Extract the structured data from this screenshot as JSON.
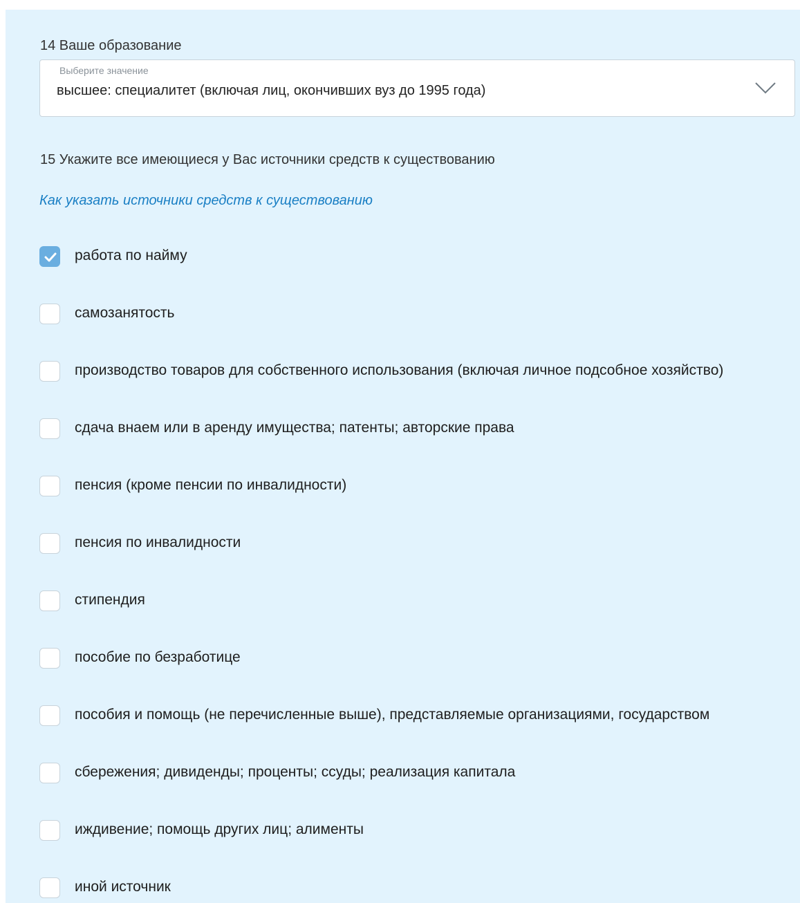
{
  "education": {
    "label": "14 Ваше образование",
    "placeholder": "Выберите значение",
    "value": "высшее: специалитет (включая лиц, окончивших вуз до 1995 года)",
    "chevron_icon": "chevron-down-icon"
  },
  "income": {
    "label": "15 Укажите все имеющиеся у Вас источники средств к существованию",
    "help_link": "Как указать источники средств к существованию",
    "options": [
      {
        "label": "работа по найму",
        "checked": true
      },
      {
        "label": "самозанятость",
        "checked": false
      },
      {
        "label": "производство товаров для собственного использования (включая личное подсобное хозяйство)",
        "checked": false
      },
      {
        "label": "сдача внаем или в аренду имущества; патенты; авторские права",
        "checked": false
      },
      {
        "label": "пенсия (кроме пенсии по инвалидности)",
        "checked": false
      },
      {
        "label": "пенсия по инвалидности",
        "checked": false
      },
      {
        "label": "стипендия",
        "checked": false
      },
      {
        "label": "пособие по безработице",
        "checked": false
      },
      {
        "label": "пособия и помощь (не перечисленные выше), представляемые организациями, государством",
        "checked": false
      },
      {
        "label": "сбережения; дивиденды; проценты; ссуды; реализация капитала",
        "checked": false
      },
      {
        "label": "иждивение; помощь других лиц; алименты",
        "checked": false
      },
      {
        "label": "иной источник",
        "checked": false
      }
    ]
  },
  "colors": {
    "panel_bg": "#e2f3fd",
    "checkbox_checked": "#6aaee0",
    "link": "#1a7fc4"
  }
}
